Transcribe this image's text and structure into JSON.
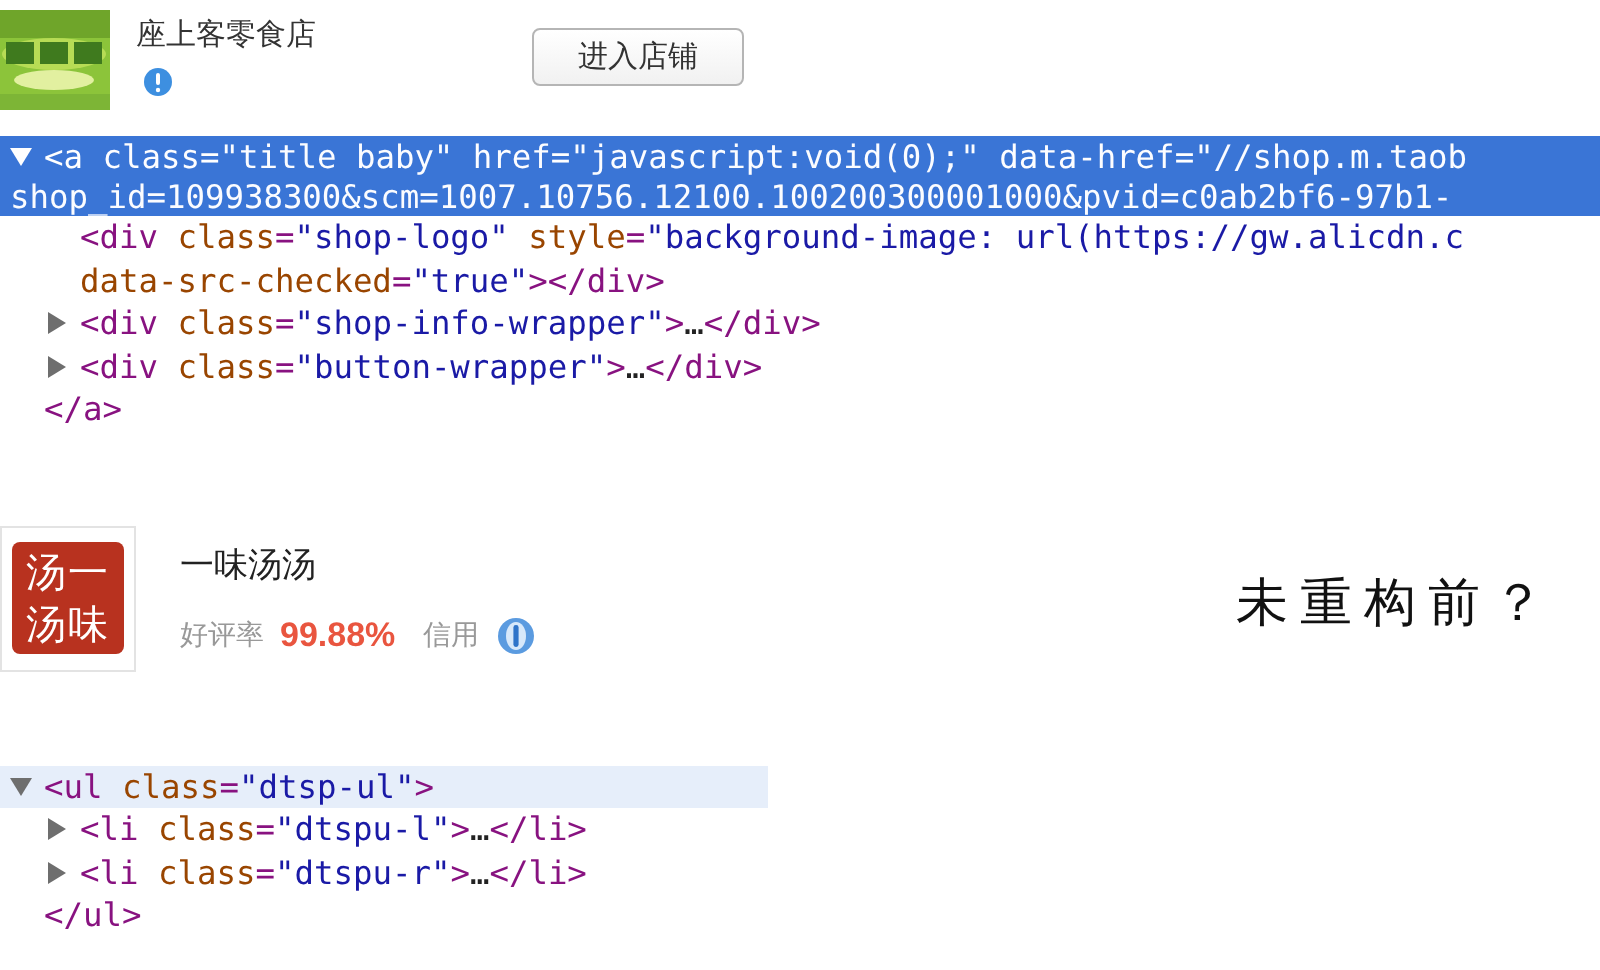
{
  "panels": [
    {
      "kind": "shop_header",
      "name": "座上客零食店",
      "button": "进入店铺"
    },
    {
      "kind": "dom_tree",
      "nodes": [
        {
          "kind": "parent",
          "expanded": true,
          "selected": true,
          "hovered": false,
          "lines": [
            [
              {
                "kind": "tag",
                "text": "<a"
              },
              {
                "kind": "attr",
                "text": " class"
              },
              {
                "kind": "tag",
                "text": "="
              },
              {
                "kind": "value",
                "text": "\"title baby\""
              },
              {
                "kind": "attr",
                "text": " href"
              },
              {
                "kind": "tag",
                "text": "="
              },
              {
                "kind": "value",
                "text": "\"javascript:void(0);\""
              },
              {
                "kind": "attr",
                "text": " data-href"
              },
              {
                "kind": "tag",
                "text": "="
              },
              {
                "kind": "value",
                "text": "\"//shop.m.taob"
              }
            ],
            [
              {
                "kind": "value",
                "text": "shop_id=109938300&scm=1007.10756.12100.100200300001000&pvid=c0ab2bf6-97b1-"
              }
            ]
          ],
          "children": [
            {
              "kind": "leaf",
              "selected": false,
              "hovered": false,
              "lines": [
                [
                  {
                    "kind": "tag",
                    "text": "<div"
                  },
                  {
                    "kind": "attr",
                    "text": " class"
                  },
                  {
                    "kind": "tag",
                    "text": "="
                  },
                  {
                    "kind": "value",
                    "text": "\"shop-logo\""
                  },
                  {
                    "kind": "attr",
                    "text": " style"
                  },
                  {
                    "kind": "tag",
                    "text": "="
                  },
                  {
                    "kind": "value",
                    "text": "\"background-image: url(https://gw.alicdn.c"
                  }
                ],
                [
                  {
                    "kind": "attr",
                    "text": "data-src-checked"
                  },
                  {
                    "kind": "tag",
                    "text": "="
                  },
                  {
                    "kind": "value",
                    "text": "\"true\""
                  },
                  {
                    "kind": "tag",
                    "text": "></div>"
                  }
                ]
              ]
            },
            {
              "kind": "parent",
              "expanded": false,
              "selected": false,
              "hovered": false,
              "lines": [
                [
                  {
                    "kind": "tag",
                    "text": "<div"
                  },
                  {
                    "kind": "attr",
                    "text": " class"
                  },
                  {
                    "kind": "tag",
                    "text": "="
                  },
                  {
                    "kind": "value",
                    "text": "\"shop-info-wrapper\""
                  },
                  {
                    "kind": "tag",
                    "text": ">"
                  },
                  {
                    "kind": "text",
                    "text": "…"
                  },
                  {
                    "kind": "tag",
                    "text": "</div>"
                  }
                ]
              ]
            },
            {
              "kind": "parent",
              "expanded": false,
              "selected": false,
              "hovered": false,
              "lines": [
                [
                  {
                    "kind": "tag",
                    "text": "<div"
                  },
                  {
                    "kind": "attr",
                    "text": " class"
                  },
                  {
                    "kind": "tag",
                    "text": "="
                  },
                  {
                    "kind": "value",
                    "text": "\"button-wrapper\""
                  },
                  {
                    "kind": "tag",
                    "text": ">"
                  },
                  {
                    "kind": "text",
                    "text": "…"
                  },
                  {
                    "kind": "tag",
                    "text": "</div>"
                  }
                ]
              ]
            }
          ],
          "close": [
            {
              "kind": "tag",
              "text": "</a>"
            }
          ]
        }
      ]
    },
    {
      "kind": "shop_card",
      "logo_lines": [
        "汤一",
        "汤味"
      ],
      "name": "一味汤汤",
      "rating_label": "好评率",
      "rating": "99.88%",
      "credit_label": "信用",
      "annotation": "未重构前？"
    },
    {
      "kind": "dom_tree",
      "nodes": [
        {
          "kind": "parent",
          "expanded": true,
          "selected": false,
          "hovered": true,
          "lines": [
            [
              {
                "kind": "tag",
                "text": "<ul"
              },
              {
                "kind": "attr",
                "text": " class"
              },
              {
                "kind": "tag",
                "text": "="
              },
              {
                "kind": "value",
                "text": "\"dtsp-ul\""
              },
              {
                "kind": "tag",
                "text": ">"
              }
            ]
          ],
          "children": [
            {
              "kind": "parent",
              "expanded": false,
              "selected": false,
              "hovered": false,
              "lines": [
                [
                  {
                    "kind": "tag",
                    "text": "<li"
                  },
                  {
                    "kind": "attr",
                    "text": " class"
                  },
                  {
                    "kind": "tag",
                    "text": "="
                  },
                  {
                    "kind": "value",
                    "text": "\"dtspu-l\""
                  },
                  {
                    "kind": "tag",
                    "text": ">"
                  },
                  {
                    "kind": "text",
                    "text": "…"
                  },
                  {
                    "kind": "tag",
                    "text": "</li>"
                  }
                ]
              ]
            },
            {
              "kind": "parent",
              "expanded": false,
              "selected": false,
              "hovered": false,
              "lines": [
                [
                  {
                    "kind": "tag",
                    "text": "<li"
                  },
                  {
                    "kind": "attr",
                    "text": " class"
                  },
                  {
                    "kind": "tag",
                    "text": "="
                  },
                  {
                    "kind": "value",
                    "text": "\"dtspu-r\""
                  },
                  {
                    "kind": "tag",
                    "text": ">"
                  },
                  {
                    "kind": "text",
                    "text": "…"
                  },
                  {
                    "kind": "tag",
                    "text": "</li>"
                  }
                ]
              ]
            }
          ],
          "close": [
            {
              "kind": "tag",
              "text": "</ul>"
            }
          ]
        }
      ]
    }
  ]
}
